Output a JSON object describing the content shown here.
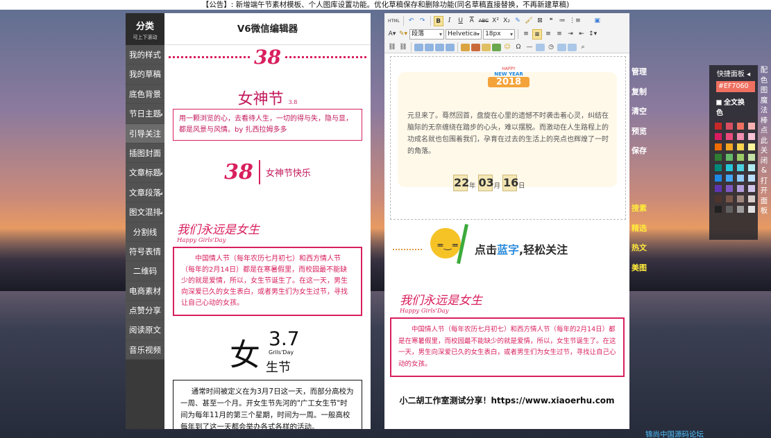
{
  "notice": "【公告】: 新增端午节素材模板、个人图库设置功能。优化草稿保存和删除功能(同名草稿直接替换，不再新建草稿)",
  "sidebar": {
    "title": "分类",
    "subtitle": "可上下滚动",
    "items": [
      {
        "label": "我的样式"
      },
      {
        "label": "我的草稿"
      },
      {
        "label": "底色背景"
      },
      {
        "label": "节日主题"
      },
      {
        "label": "引导关注"
      },
      {
        "label": "插图封面"
      },
      {
        "label": "文章标题"
      },
      {
        "label": "文章段落"
      },
      {
        "label": "图文混排"
      },
      {
        "label": "分割线"
      },
      {
        "label": "符号表情"
      },
      {
        "label": "二维码"
      },
      {
        "label": "电商素材"
      },
      {
        "label": "点赞分享"
      },
      {
        "label": "阅读原文"
      },
      {
        "label": "音乐视频"
      }
    ]
  },
  "templates": {
    "title": "V6微信编辑器",
    "logo1": "38",
    "goddess_title": "女神节",
    "goddess_sub": "3.8",
    "goddess_text": "用一颗浏览的心，去看待人生，一切的得与失，隐与显，都是风景与风情。by 扎西拉姆多多",
    "logo2": "38",
    "logo2_text": "女神节快乐",
    "girls_script": "我们永远是女生",
    "girls_sub": "Happy Girls'Day",
    "girls_text": "中国情人节（每年农历七月初七）和西方情人节（每年的2月14日）都是在寒暑假里，而校园最不能缺少的就是爱情，所以，女生节诞生了。在这一天，男生向深爱已久的女生表白，或者男生们为女生过节，寻找让自己心动的女孩。",
    "big_date": "3.7",
    "grils_day": "Grils'Day",
    "nv": "女",
    "sheng_jie": "生节",
    "days_text": "通常时间被定义在为3月7日这一天，而部分高校为一周、甚至一个月。开女生节先河的\"广工女生节\"时间为每年11月的第三个星期，时间为一周。一般高校每年到了这一天都会举办各式各样的活动。"
  },
  "editor": {
    "toolbar_row1": [
      "HTML",
      "↶",
      "↷",
      "B",
      "I",
      "U",
      "A",
      "ABC",
      "X²",
      "X₂",
      "✎",
      "🖌",
      "⊠",
      "❝",
      "≔",
      "⋮≡"
    ],
    "paragraph_select": "段落",
    "font_select": "Helvetica",
    "size_select": "18px",
    "newyear": {
      "badge_top": "HAPPY",
      "badge_main": "NEW YEAR",
      "badge_year": "2018",
      "paragraph": "元旦来了。蓦然回首，盘旋在心里的遗憾不时袭击着心灵，纠结在脑际的无奈缠绕在踏步的心头，难以摆脱。而激动在人生路程上的功成名就也包围着我们，孕育在过去的生活上的亮点也辉煌了一时的角落。",
      "counter": [
        {
          "value": "22",
          "unit": "年"
        },
        {
          "value": "03",
          "unit": "月"
        },
        {
          "value": "16",
          "unit": "日"
        }
      ]
    },
    "follow_text_a": "点击",
    "follow_text_b": "蓝字",
    "follow_text_c": ",轻松关注",
    "girls_script": "我们永远是女生",
    "girls_sub": "Happy Girls'Day",
    "girls_text": "中国情人节（每年农历七月初七）和西方情人节（每年的2月14日）都是在寒暑假里，而校园最不能缺少的就是爱情，所以，女生节诞生了。在这一天，男生向深爱已久的女生表白，或者男生们为女生过节，寻找让自己心动的女孩。",
    "footer": "小二胡工作室测试分享！https://www.xiaoerhu.com"
  },
  "actions": {
    "group1": [
      "管理",
      "复制",
      "清空",
      "预览",
      "保存"
    ],
    "group2": [
      "搜素",
      "精选",
      "热文",
      "美图"
    ]
  },
  "quick_panel": {
    "title": "快捷面板",
    "color_value": "#EF7060",
    "full_color_label": "全文换色",
    "vertical_text": "配色图魔法棒点此关闭&打开面板",
    "swatches": [
      "#c62828",
      "#d84f62",
      "#ef7060",
      "#f7b0b0",
      "#d81b60",
      "#e94b7b",
      "#f48fb1",
      "#f8c2d6",
      "#ef6c00",
      "#f5a623",
      "#ffd54f",
      "#fff59d",
      "#2e7d32",
      "#66bb6a",
      "#9ccc65",
      "#c5e1a5",
      "#00897b",
      "#26c6da",
      "#4dd0e1",
      "#b2ebf2",
      "#1e88e5",
      "#42a5f5",
      "#90caf9",
      "#bbdefb",
      "#5e35b1",
      "#7e57c2",
      "#b39ddb",
      "#d1c4e9",
      "#4e342e",
      "#795548",
      "#a1887f",
      "#d7ccc8",
      "#212121",
      "#616161",
      "#9e9e9e",
      "#e0e0e0"
    ]
  },
  "bottom_link": "锦尚中国源码论坛"
}
